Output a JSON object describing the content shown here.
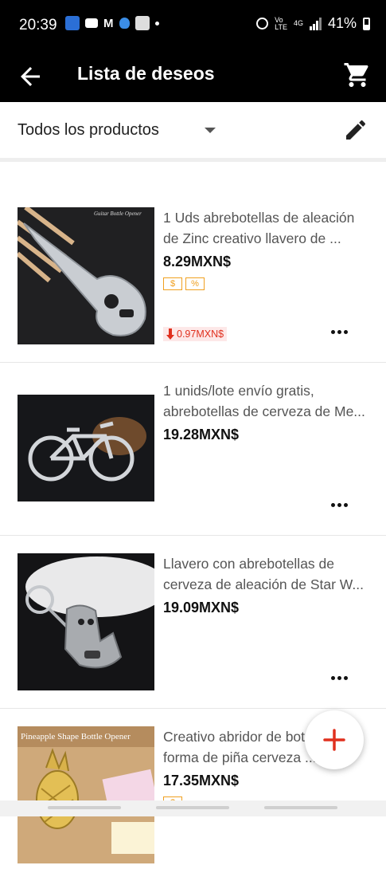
{
  "status_bar": {
    "time": "20:39",
    "battery": "41%",
    "network": "4G",
    "icons": [
      "bitwarden-icon",
      "gmail-icon",
      "m-icon",
      "shield-icon",
      "chat-icon",
      "dot-icon",
      "alarm-icon",
      "volte-icon",
      "data-icon",
      "signal-icon",
      "battery-icon"
    ]
  },
  "app_bar": {
    "title": "Lista de deseos",
    "back_icon": "arrow-left-icon",
    "cart_icon": "shopping-cart-icon"
  },
  "filter": {
    "label": "Todos los productos",
    "edit_icon": "pencil-icon"
  },
  "items": [
    {
      "title": "1 Uds abrebotellas de aleación de Zinc creativo llavero de ...",
      "price": "8.29MXN$",
      "badges": [
        "$",
        "%"
      ],
      "price_drop": "0.97MXN$",
      "image_caption": "Guitar Bottle Opener"
    },
    {
      "title": "1 unids/lote envío gratis, abrebotellas de cerveza de Me...",
      "price": "19.28MXN$"
    },
    {
      "title": "Llavero con abrebotellas de cerveza de aleación de Star W...",
      "price": "19.09MXN$"
    },
    {
      "title": "Creativo abridor de botellas en forma de piña cerveza ...",
      "price": "17.35MXN$",
      "badges": [
        "$"
      ],
      "image_caption": "Pineapple Shape Bottle Opener"
    }
  ],
  "fab": {
    "label": "+"
  },
  "colors": {
    "bar_background": "#000000",
    "accent_red": "#e0301e",
    "badge_orange": "#f0a020",
    "price_drop_bg": "#fde8e8"
  }
}
